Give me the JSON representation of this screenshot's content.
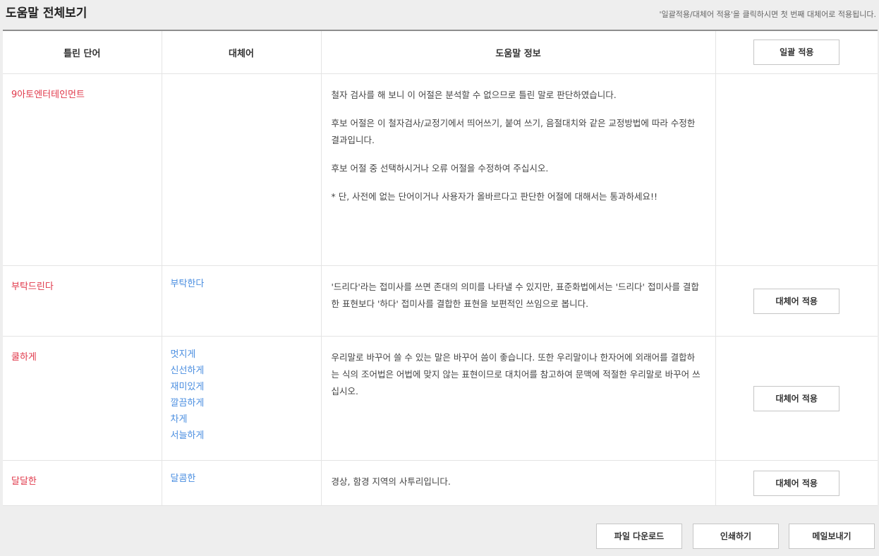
{
  "header": {
    "title": "도움말 전체보기",
    "note": "'일괄적용/대체어 적용'을 클릭하시면 첫 번째 대체어로 적용됩니다."
  },
  "table": {
    "columns": [
      "틀린 단어",
      "대체어",
      "도움말 정보"
    ],
    "apply_all_label": "일괄 적용",
    "rows": [
      {
        "wrong": "9아토엔터테인먼트",
        "substitutes": [],
        "info": [
          "철자 검사를 해 보니 이 어절은 분석할 수 없으므로 틀린 말로 판단하였습니다.",
          "후보 어절은 이 철자검사/교정기에서 띄어쓰기, 붙여 쓰기, 음절대치와 같은 교정방법에 따라 수정한 결과입니다.",
          "후보 어절 중 선택하시거나 오류 어절을 수정하여 주십시오.",
          "* 단, 사전에 없는 단어이거나 사용자가 올바르다고 판단한 어절에 대해서는 통과하세요!!"
        ],
        "button": ""
      },
      {
        "wrong": "부탁드린다",
        "substitutes": [
          "부탁한다"
        ],
        "info": [
          "'드리다'라는 접미사를 쓰면 존대의 의미를 나타낼 수 있지만, 표준화법에서는 '드리다' 접미사를 결합한 표현보다 '하다' 접미사를 결합한 표현을 보편적인 쓰임으로 봅니다."
        ],
        "button": "대체어 적용"
      },
      {
        "wrong": "쿨하게",
        "substitutes": [
          "멋지게",
          "신선하게",
          "재미있게",
          "깔끔하게",
          "차게",
          "서늘하게"
        ],
        "info": [
          "우리말로 바꾸어 쓸 수 있는 말은 바꾸어 씀이 좋습니다. 또한 우리말이나 한자어에 외래어를 결합하는 식의 조어법은 어법에 맞지 않는 표현이므로 대치어를 참고하여 문맥에 적절한 우리말로 바꾸어 쓰십시오."
        ],
        "button": "대체어 적용"
      },
      {
        "wrong": "달달한",
        "substitutes": [
          "달콤한"
        ],
        "info": [
          "경상, 함경 지역의 사투리입니다."
        ],
        "button": "대체어 적용"
      }
    ]
  },
  "footer": {
    "download_label": "파일 다운로드",
    "print_label": "인쇄하기",
    "mail_label": "메일보내기"
  },
  "colors": {
    "wrong_word": "#e0384a",
    "substitute": "#4a8ee0",
    "background": "#eeeeee"
  }
}
